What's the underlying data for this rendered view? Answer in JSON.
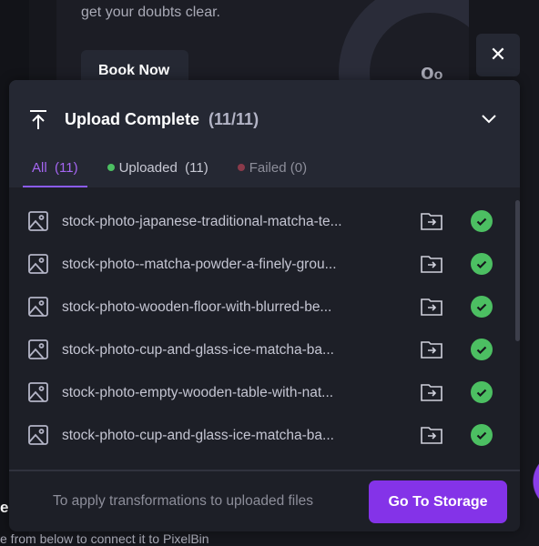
{
  "background": {
    "text": "get your doubts clear.",
    "book_label": "Book Now",
    "left_heading": "e",
    "left_text": "e from below to connect it to PixelBin"
  },
  "panel": {
    "title": "Upload Complete",
    "count": "(11/11)",
    "tabs": [
      {
        "label": "All",
        "count": "(11)"
      },
      {
        "label": "Uploaded",
        "count": "(11)",
        "dot": "#4cbf62"
      },
      {
        "label": "Failed",
        "count": "(0)",
        "dot": "#8a3a4a"
      }
    ],
    "files": [
      {
        "name": "stock-photo-japanese-traditional-matcha-te...",
        "status": "uploaded"
      },
      {
        "name": "stock-photo--matcha-powder-a-finely-grou...",
        "status": "uploaded"
      },
      {
        "name": "stock-photo-wooden-floor-with-blurred-be...",
        "status": "uploaded"
      },
      {
        "name": "stock-photo-cup-and-glass-ice-matcha-ba...",
        "status": "uploaded"
      },
      {
        "name": "stock-photo-empty-wooden-table-with-nat...",
        "status": "uploaded"
      },
      {
        "name": "stock-photo-cup-and-glass-ice-matcha-ba...",
        "status": "uploaded"
      }
    ],
    "footer_hint": "To apply transformations to uploaded files",
    "go_label": "Go To Storage"
  },
  "colors": {
    "accent": "#8433e8",
    "success": "#4cbf62"
  }
}
